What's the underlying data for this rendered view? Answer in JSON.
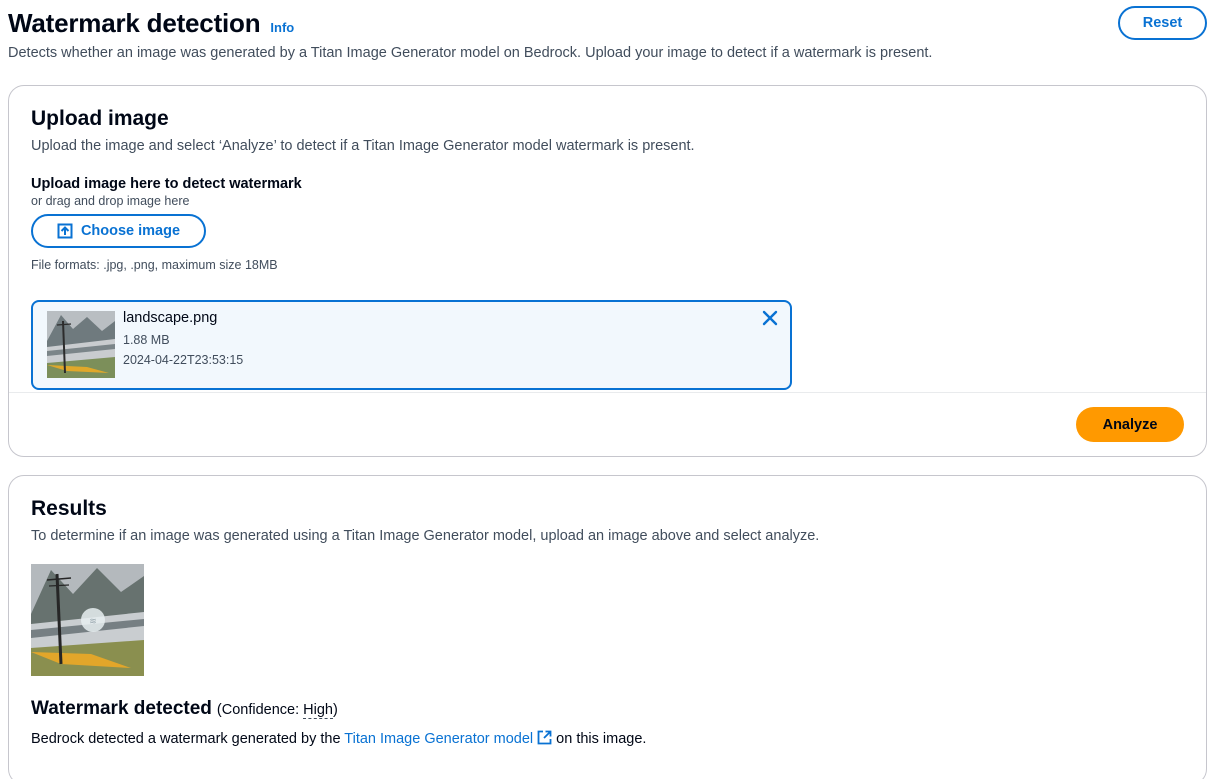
{
  "header": {
    "title": "Watermark detection",
    "info_label": "Info",
    "description": "Detects whether an image was generated by a Titan Image Generator model on Bedrock. Upload your image to detect if a watermark is present.",
    "reset_label": "Reset"
  },
  "upload": {
    "title": "Upload image",
    "description": "Upload the image and select ‘Analyze’ to detect if a Titan Image Generator model watermark is present.",
    "field_label": "Upload image here to detect watermark",
    "field_sub": "or drag and drop image here",
    "choose_label": "Choose image",
    "formats": "File formats: .jpg, .png, maximum size 18MB",
    "file": {
      "name": "landscape.png",
      "size": "1.88 MB",
      "date": "2024-04-22T23:53:15"
    },
    "analyze_label": "Analyze"
  },
  "results": {
    "title": "Results",
    "description": "To determine if an image was generated using a Titan Image Generator model, upload an image above and select analyze.",
    "detect_title": "Watermark detected",
    "confidence_prefix": "(Confidence: ",
    "confidence_value": "High",
    "confidence_suffix": ")",
    "text_before": "Bedrock detected a watermark generated by the ",
    "link_text": "Titan Image Generator model",
    "text_after": " on this image."
  },
  "colors": {
    "accent": "#0972d3",
    "primary_button": "#ff9900",
    "token_background": "#f2f8fd"
  },
  "icons": [
    "upload-icon",
    "close-icon",
    "external-link-icon"
  ]
}
